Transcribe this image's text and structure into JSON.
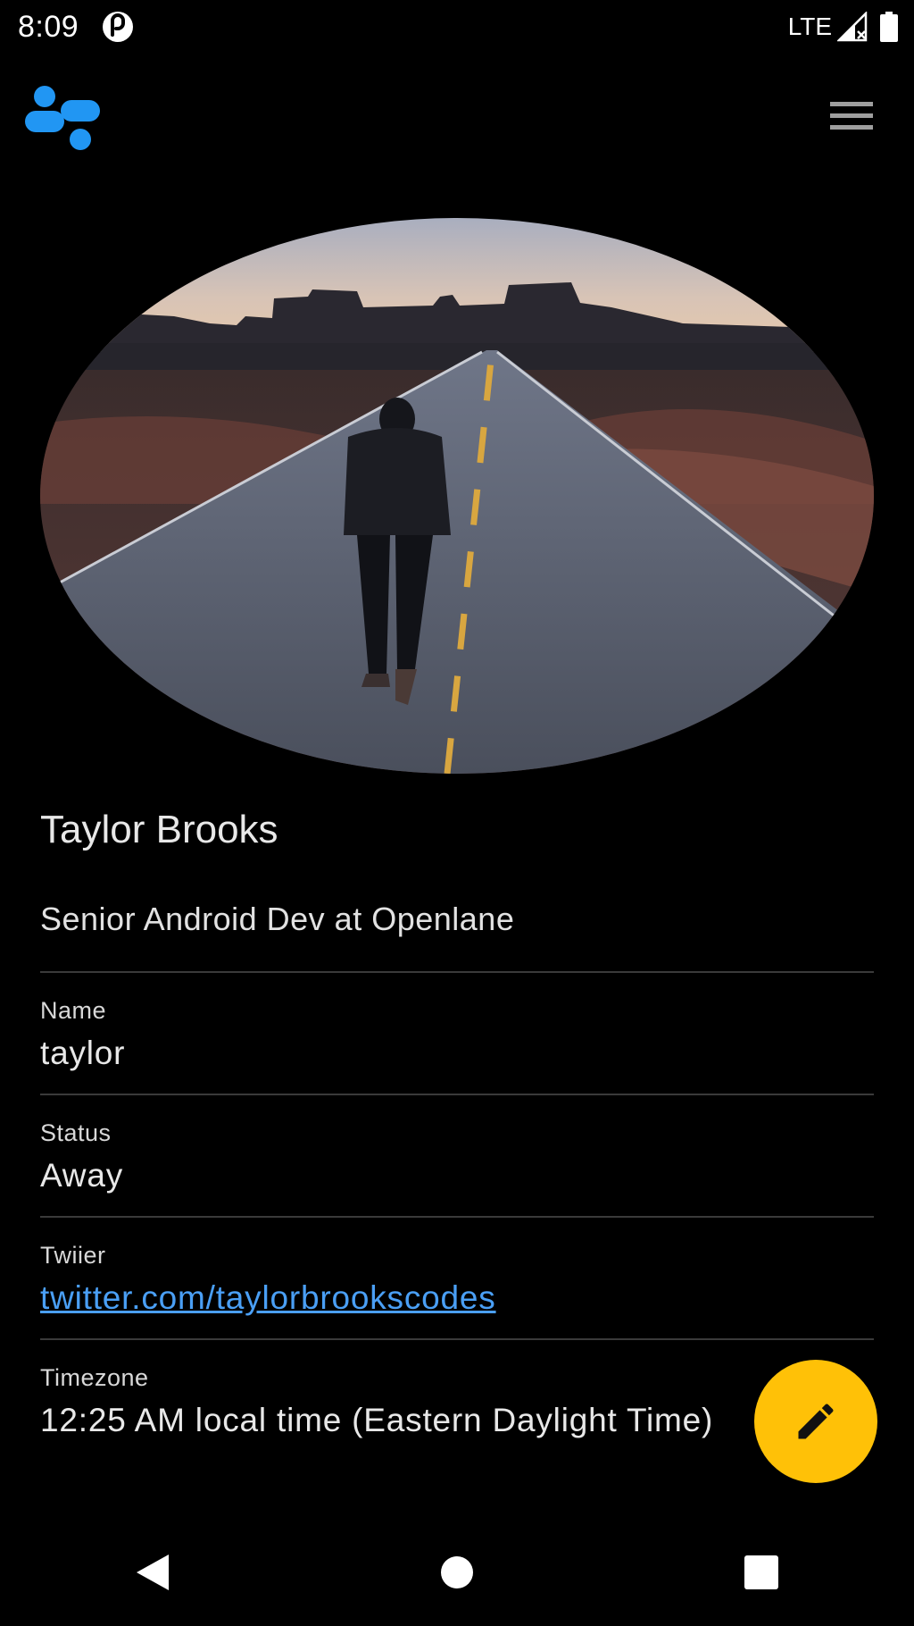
{
  "status_bar": {
    "time": "8:09",
    "network": "LTE",
    "icons": [
      "app-notification-icon",
      "signal-icon",
      "battery-icon"
    ]
  },
  "app_bar": {
    "logo": "app-logo-icon",
    "menu_icon": "hamburger-menu-icon"
  },
  "profile": {
    "display_name": "Taylor Brooks",
    "headline": "Senior Android Dev at Openlane",
    "photo": "person-walking-on-desert-road-photo"
  },
  "fields": {
    "name": {
      "label": "Name",
      "value": "taylor"
    },
    "status": {
      "label": "Status",
      "value": "Away"
    },
    "twitter": {
      "label": "Twiier",
      "value": "twitter.com/taylorbrookscodes"
    },
    "timezone": {
      "label": "Timezone",
      "value": "12:25 AM local time (Eastern Daylight Time)"
    }
  },
  "fab": {
    "icon": "edit-pencil-icon"
  },
  "nav_bar": {
    "icons": [
      "back-icon",
      "home-icon",
      "recents-icon"
    ]
  },
  "colors": {
    "background": "#000000",
    "accent": "#2196f3",
    "link": "#4a9ff5",
    "fab": "#ffc107",
    "divider": "#3a3a3a"
  }
}
